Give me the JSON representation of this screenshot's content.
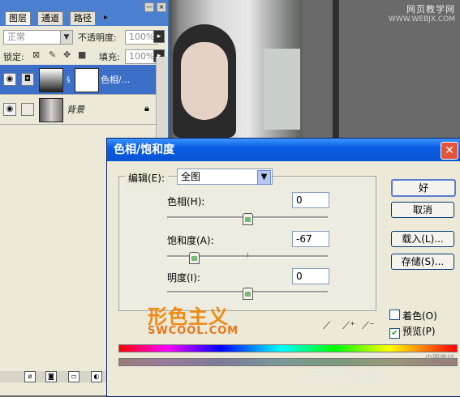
{
  "watermark_top": {
    "line1": "网页教学网",
    "line2": "WWW.WEBJX.COM"
  },
  "layers_panel": {
    "tabs": [
      "图层",
      "通道",
      "路径"
    ],
    "blend_mode": "正常",
    "opacity_label": "不透明度:",
    "opacity_value": "100%",
    "lock_label": "锁定:",
    "fill_label": "填充:",
    "fill_value": "100%",
    "layers": [
      {
        "name": "色相/...",
        "selected": true
      },
      {
        "name": "背景",
        "selected": false
      }
    ]
  },
  "dialog": {
    "title": "色相/饱和度",
    "edit_label": "编辑(E):",
    "edit_value": "全图",
    "fields": [
      {
        "label": "色相(H):",
        "value": "0",
        "level": 0.5
      },
      {
        "label": "饱和度(A):",
        "value": "-67",
        "level": 0.165
      },
      {
        "label": "明度(I):",
        "value": "0",
        "level": 0.5
      }
    ],
    "buttons": {
      "ok": "好",
      "cancel": "取消",
      "load": "载入(L)...",
      "save": "存储(S)..."
    },
    "checkboxes": {
      "colorize": "着色(O)",
      "preview": "预览(P)"
    },
    "preview_checked": true,
    "colorize_checked": false
  },
  "brand_logo": {
    "chinese": "形色主义",
    "english": "SWCOOL.COM"
  },
  "watermark_bottom": "阿里西西",
  "watermark_small": "中国西站"
}
